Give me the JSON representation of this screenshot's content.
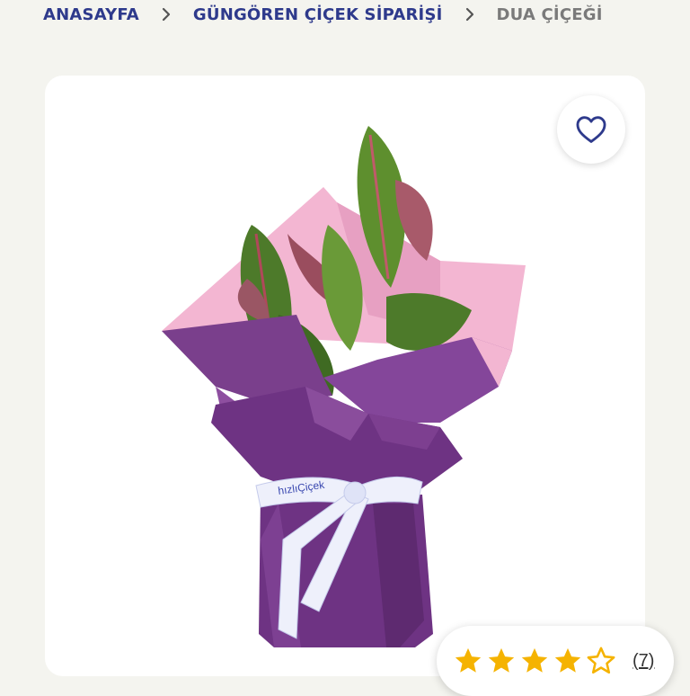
{
  "breadcrumb": {
    "items": [
      {
        "label": "ANASAYFA"
      },
      {
        "label": "GÜNGÖREN ÇİÇEK SİPARİŞİ"
      },
      {
        "label": "DUA ÇİÇEĞİ"
      }
    ],
    "separator_icon": "chevron-right-icon"
  },
  "favorite": {
    "icon": "heart-outline-icon"
  },
  "product": {
    "image_name": "product-photo",
    "ribbon_text": "hızlıÇiçek"
  },
  "rating": {
    "value": 4.5,
    "max": 5,
    "review_count": "(7)"
  },
  "colors": {
    "accent": "#2e3a8c",
    "star": "#f5b301",
    "wrap_purple": "#7a3f8c",
    "wrap_pink": "#f3b6d2"
  }
}
